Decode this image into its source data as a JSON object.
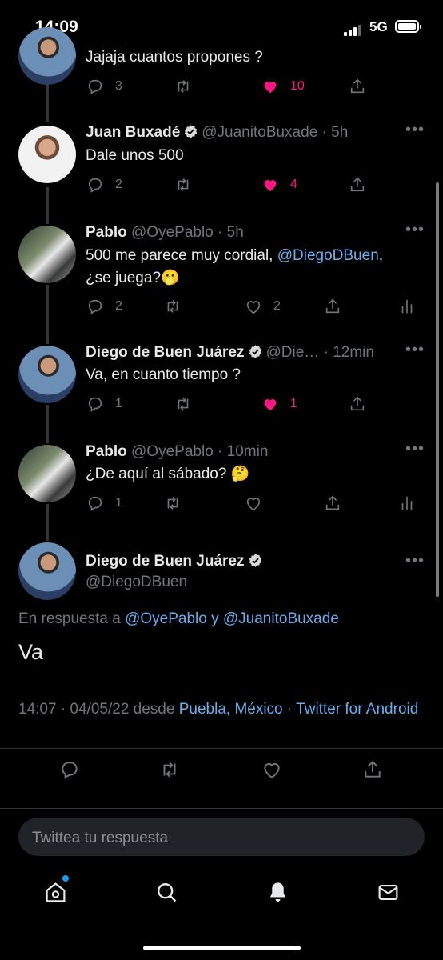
{
  "status_bar": {
    "time": "14:09",
    "network": "5G"
  },
  "tweets": [
    {
      "text": "Jajaja cuantos propones ?",
      "stats": {
        "replies": "3",
        "likes": "10"
      },
      "liked": true
    },
    {
      "name": "Juan Buxadé",
      "verified": true,
      "handle": "@JuanitoBuxade",
      "time": "· 5h",
      "text": "Dale unos 500",
      "stats": {
        "replies": "2",
        "likes": "4"
      },
      "liked": true
    },
    {
      "name": "Pablo",
      "handle": "@OyePablo",
      "time": "· 5h",
      "text_line1": "500 me parece muy cordial, ",
      "mention": "@DiegoDBuen",
      "text_line1_end": ",",
      "text_line2": "¿se juega?🫢",
      "stats": {
        "replies": "2",
        "likes": "2"
      },
      "liked": false
    },
    {
      "name": "Diego de Buen Juárez",
      "verified": true,
      "handle": "@Die…",
      "time": "· 12min",
      "text": "Va, en cuanto tiempo ?",
      "stats": {
        "replies": "1",
        "likes": "1"
      },
      "liked": true
    },
    {
      "name": "Pablo",
      "handle": "@OyePablo",
      "time": "· 10min",
      "text": "¿De aquí al sábado? 🤔",
      "stats": {
        "replies": "1",
        "likes": ""
      },
      "liked": false
    }
  ],
  "main_tweet": {
    "name": "Diego de Buen Juárez",
    "verified": true,
    "handle": "@DiegoDBuen",
    "reply_prefix": "En respuesta a ",
    "reply_user1": "@OyePablo",
    "reply_joiner": " y ",
    "reply_user2": "@JuanitoBuxade",
    "text": "Va",
    "timestamp": "14:07 · 04/05/22 desde ",
    "location": "Puebla, México",
    "sep": " · ",
    "client": "Twitter for Android"
  },
  "reply_input": {
    "placeholder": "Twittea tu respuesta"
  },
  "bottom_nav": [
    "home-icon",
    "search-icon",
    "notifications-icon",
    "messages-icon"
  ],
  "colors": {
    "like": "#f91880",
    "link": "#6aaef0",
    "muted": "#71767b",
    "background": "#000000"
  }
}
